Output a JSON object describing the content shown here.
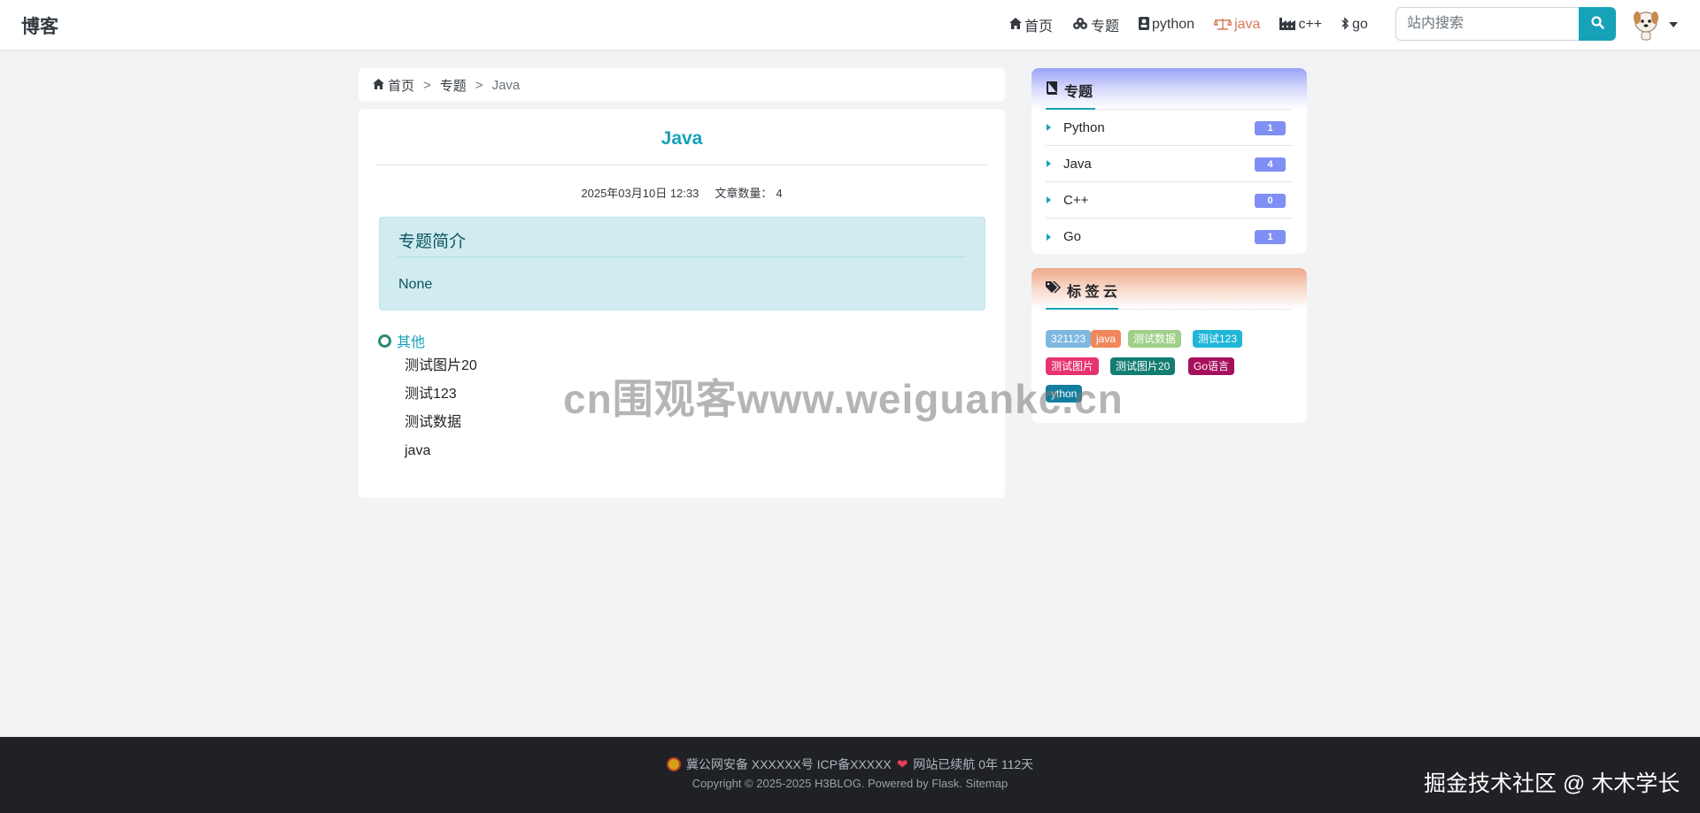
{
  "navbar": {
    "brand": "博客",
    "links": [
      {
        "label": "首页",
        "icon": "home-icon"
      },
      {
        "label": "专题",
        "icon": "cubes-icon"
      },
      {
        "label": "python",
        "icon": "python-icon"
      },
      {
        "label": "java",
        "icon": "balance-scale-icon",
        "active": true
      },
      {
        "label": "c++",
        "icon": "industry-icon"
      },
      {
        "label": "go",
        "icon": "bluetooth-icon"
      }
    ],
    "search_placeholder": "站内搜索",
    "accent_color": "#17a2b8",
    "active_color": "#d9795a"
  },
  "breadcrumb": {
    "home": "首页",
    "section": "专题",
    "current": "Java",
    "separator": ">"
  },
  "topic": {
    "title": "Java",
    "date": "2025年03月10日 12:33",
    "article_count_label": "文章数量：",
    "article_count": "4",
    "intro_title": "专题简介",
    "intro_body": "None",
    "group_label": "其他",
    "articles": [
      "测试图片20",
      "测试123",
      "测试数据",
      "java"
    ]
  },
  "sidebar": {
    "topics_title": "专题",
    "topics": [
      {
        "name": "Python",
        "count": "1"
      },
      {
        "name": "Java",
        "count": "4"
      },
      {
        "name": "C++",
        "count": "0"
      },
      {
        "name": "Go",
        "count": "1"
      }
    ],
    "tags_title": "标 签 云",
    "tags": [
      {
        "label": "321123",
        "color": "#7eb8e0"
      },
      {
        "label": "java",
        "color": "#f0875a"
      },
      {
        "label": "测试数据",
        "color": "#9fd08a"
      },
      {
        "label": "测试123",
        "color": "#1fb6d8"
      },
      {
        "label": "测试图片",
        "color": "#e6336e"
      },
      {
        "label": "测试图片20",
        "color": "#137d71"
      },
      {
        "label": "Go语言",
        "color": "#a5105c"
      },
      {
        "label": "ython",
        "color": "#127fa0"
      }
    ]
  },
  "watermark": "cn围观客www.weiguankc.cn",
  "footer": {
    "line1": "冀公网安备 XXXXXX号 ICP备XXXXX",
    "line1_suffix": "网站已续航 0年 112天",
    "line2": "Copyright © 2025-2025 H3BLOG. Powered by Flask. Sitemap",
    "community": "掘金技术社区 @ 木木学长"
  }
}
